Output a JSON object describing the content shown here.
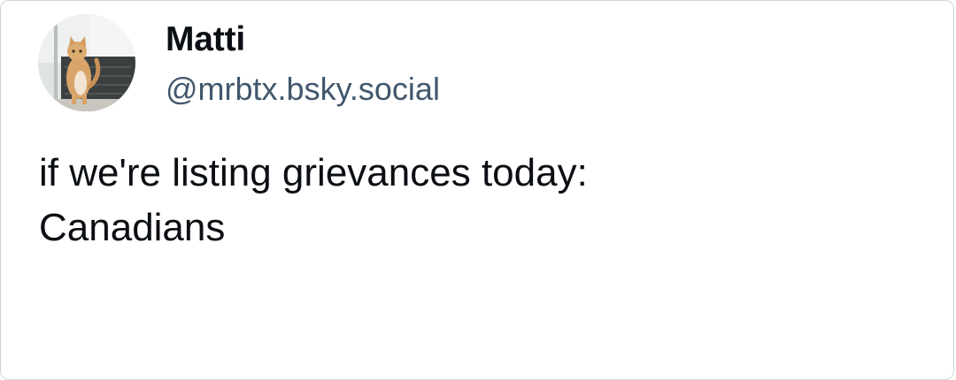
{
  "author": {
    "display_name": "Matti",
    "handle": "@mrbtx.bsky.social",
    "avatar_icon": "cat-avatar-photo"
  },
  "post": {
    "lines": [
      "if we're listing grievances today:",
      "Canadians"
    ]
  },
  "colors": {
    "name": "#0b0f14",
    "handle": "#42576c",
    "text": "#0b0f14",
    "border": "#cfd5dc",
    "background": "#ffffff"
  }
}
